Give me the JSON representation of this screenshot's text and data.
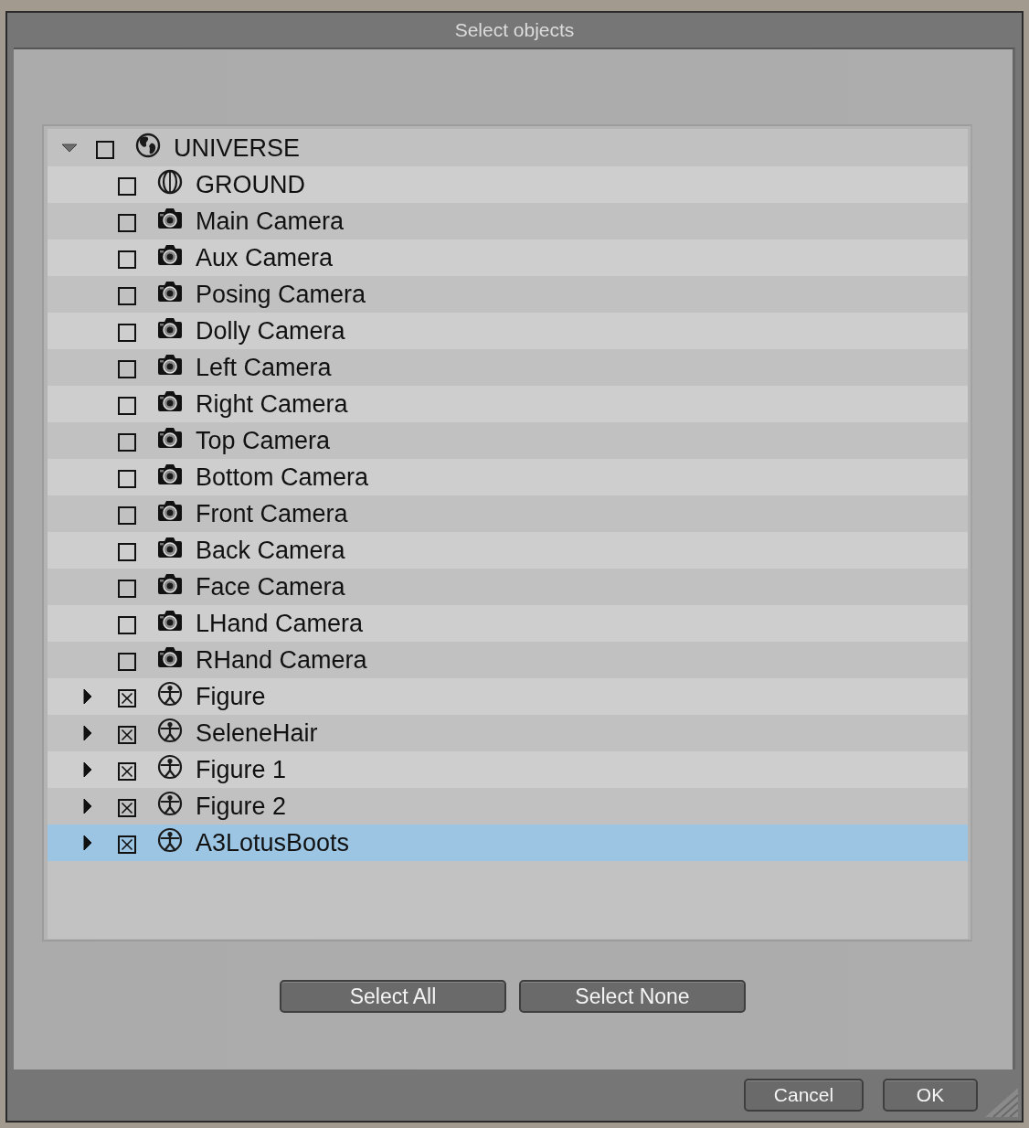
{
  "window": {
    "title": "Select objects"
  },
  "tree": {
    "items": [
      {
        "label": "UNIVERSE",
        "kind": "globe",
        "expanded": true,
        "checked": false,
        "selected": false,
        "children": [
          {
            "label": "GROUND",
            "kind": "sphere",
            "checked": false,
            "selected": false
          },
          {
            "label": "Main Camera",
            "kind": "camera",
            "checked": false,
            "selected": false
          },
          {
            "label": "Aux Camera",
            "kind": "camera",
            "checked": false,
            "selected": false
          },
          {
            "label": "Posing Camera",
            "kind": "camera",
            "checked": false,
            "selected": false
          },
          {
            "label": "Dolly Camera",
            "kind": "camera",
            "checked": false,
            "selected": false
          },
          {
            "label": "Left Camera",
            "kind": "camera",
            "checked": false,
            "selected": false
          },
          {
            "label": "Right Camera",
            "kind": "camera",
            "checked": false,
            "selected": false
          },
          {
            "label": "Top Camera",
            "kind": "camera",
            "checked": false,
            "selected": false
          },
          {
            "label": "Bottom Camera",
            "kind": "camera",
            "checked": false,
            "selected": false
          },
          {
            "label": "Front Camera",
            "kind": "camera",
            "checked": false,
            "selected": false
          },
          {
            "label": "Back Camera",
            "kind": "camera",
            "checked": false,
            "selected": false
          },
          {
            "label": "Face Camera",
            "kind": "camera",
            "checked": false,
            "selected": false
          },
          {
            "label": "LHand Camera",
            "kind": "camera",
            "checked": false,
            "selected": false
          },
          {
            "label": "RHand Camera",
            "kind": "camera",
            "checked": false,
            "selected": false
          },
          {
            "label": "Figure",
            "kind": "figure",
            "expanded": false,
            "checked": true,
            "selected": false
          },
          {
            "label": "SeleneHair",
            "kind": "figure",
            "expanded": false,
            "checked": true,
            "selected": false
          },
          {
            "label": "Figure 1",
            "kind": "figure",
            "expanded": false,
            "checked": true,
            "selected": false
          },
          {
            "label": "Figure 2",
            "kind": "figure",
            "expanded": false,
            "checked": true,
            "selected": false
          },
          {
            "label": "A3LotusBoots",
            "kind": "figure",
            "expanded": false,
            "checked": true,
            "selected": true
          }
        ]
      }
    ]
  },
  "selection_buttons": [
    {
      "label": "Select All"
    },
    {
      "label": "Select None"
    }
  ],
  "footer_buttons": [
    {
      "label": "Cancel"
    },
    {
      "label": "OK"
    }
  ]
}
